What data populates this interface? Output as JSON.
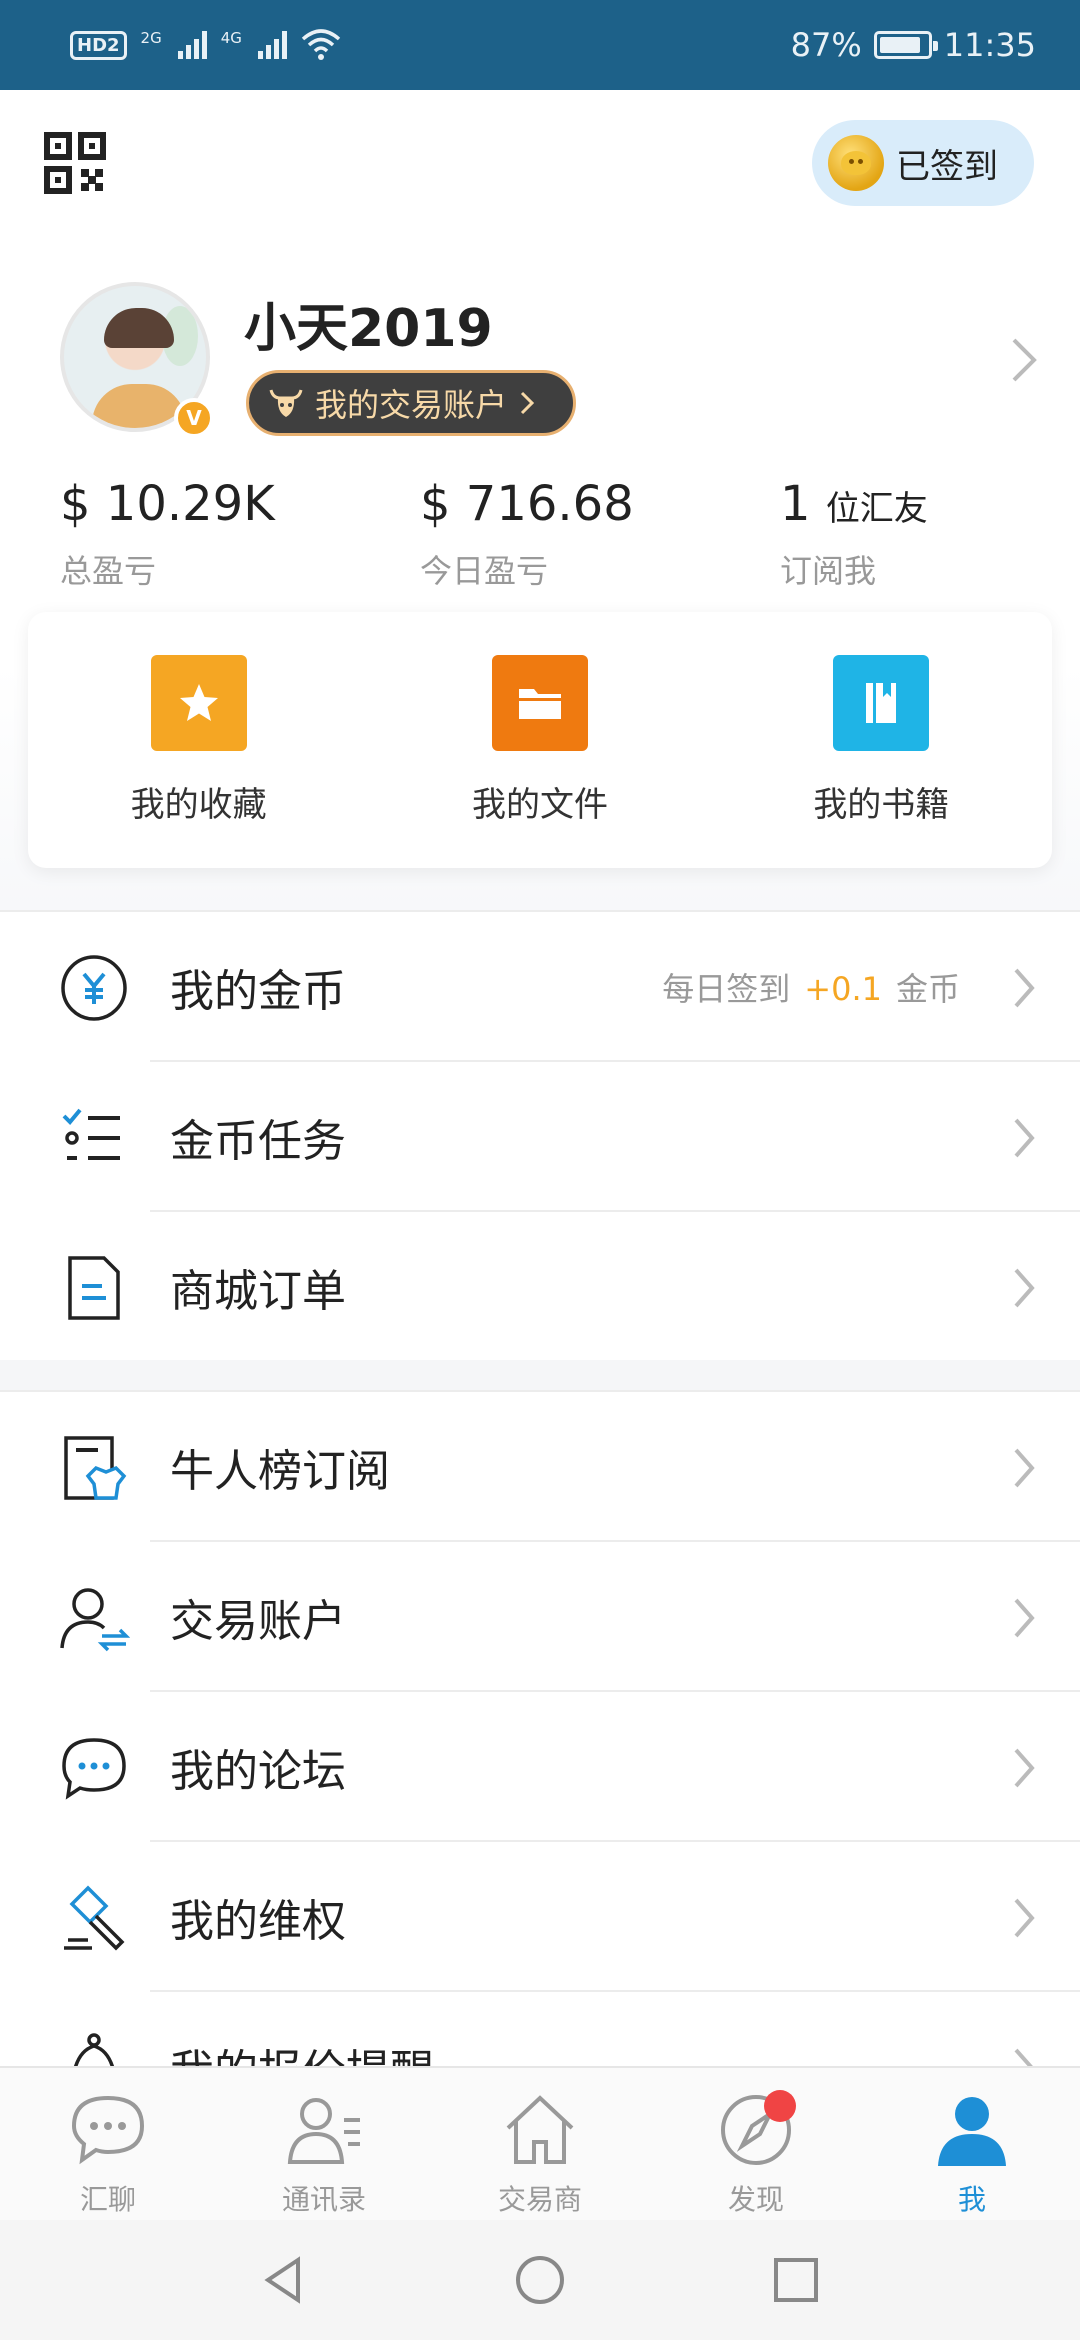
{
  "status_bar": {
    "hd": "HD",
    "hd_sub": "2",
    "net1": "2G",
    "net2": "4G",
    "battery_pct": "87%",
    "battery_level": 0.87,
    "time": "11:35"
  },
  "header": {
    "signed_label": "已签到",
    "username": "小天2019",
    "account_pill": "我的交易账户",
    "verified_mark": "V"
  },
  "stats": [
    {
      "value": "$ 10.29K",
      "label": "总盈亏"
    },
    {
      "value": "$ 716.68",
      "label": "今日盈亏"
    },
    {
      "value": "1",
      "unit": "位汇友",
      "label": "订阅我"
    }
  ],
  "shortcuts": [
    {
      "label": "我的收藏",
      "icon": "star-icon",
      "color": "#f5a623"
    },
    {
      "label": "我的文件",
      "icon": "folder-icon",
      "color": "#ef7a10"
    },
    {
      "label": "我的书籍",
      "icon": "book-icon",
      "color": "#1fb4e6"
    }
  ],
  "menu_group1": [
    {
      "label": "我的金币",
      "icon": "yuan-coin-icon",
      "extra": {
        "prefix": "每日签到",
        "plus": "+0.1",
        "suffix": "金币"
      }
    },
    {
      "label": "金币任务",
      "icon": "task-list-icon"
    },
    {
      "label": "商城订单",
      "icon": "order-document-icon"
    }
  ],
  "menu_group2": [
    {
      "label": "牛人榜订阅",
      "icon": "subscription-icon"
    },
    {
      "label": "交易账户",
      "icon": "account-transfer-icon"
    },
    {
      "label": "我的论坛",
      "icon": "chat-bubble-icon"
    },
    {
      "label": "我的维权",
      "icon": "gavel-icon"
    },
    {
      "label": "我的报价提醒",
      "icon": "alarm-bell-icon"
    }
  ],
  "bottom_nav": [
    {
      "label": "汇聊",
      "icon": "chat-icon"
    },
    {
      "label": "通讯录",
      "icon": "contacts-icon"
    },
    {
      "label": "交易商",
      "icon": "home-icon"
    },
    {
      "label": "发现",
      "icon": "compass-icon",
      "badge": true
    },
    {
      "label": "我",
      "icon": "person-icon",
      "active": true
    }
  ],
  "colors": {
    "status_bar": "#1d6189",
    "accent_blue": "#1e8fd6",
    "gold": "#f5a623",
    "badge_red": "#f04444"
  }
}
